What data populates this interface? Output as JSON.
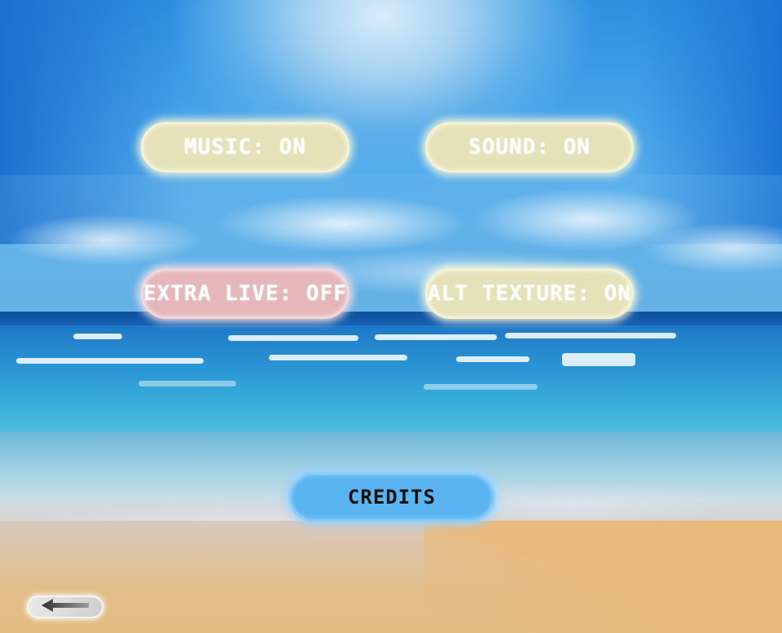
{
  "settings": {
    "music_label": "MUSIC: ON",
    "sound_label": "SOUND: ON",
    "extra_live_label": "EXTRA LIVE: OFF",
    "alt_texture_label": "ALT TEXTURE: ON"
  },
  "credits_label": "CREDITS",
  "back_icon": "arrow-left-icon",
  "colors": {
    "toggle_on": "#e5e1b9",
    "toggle_off": "#e5b7ba",
    "credits": "#5ab4f2"
  }
}
